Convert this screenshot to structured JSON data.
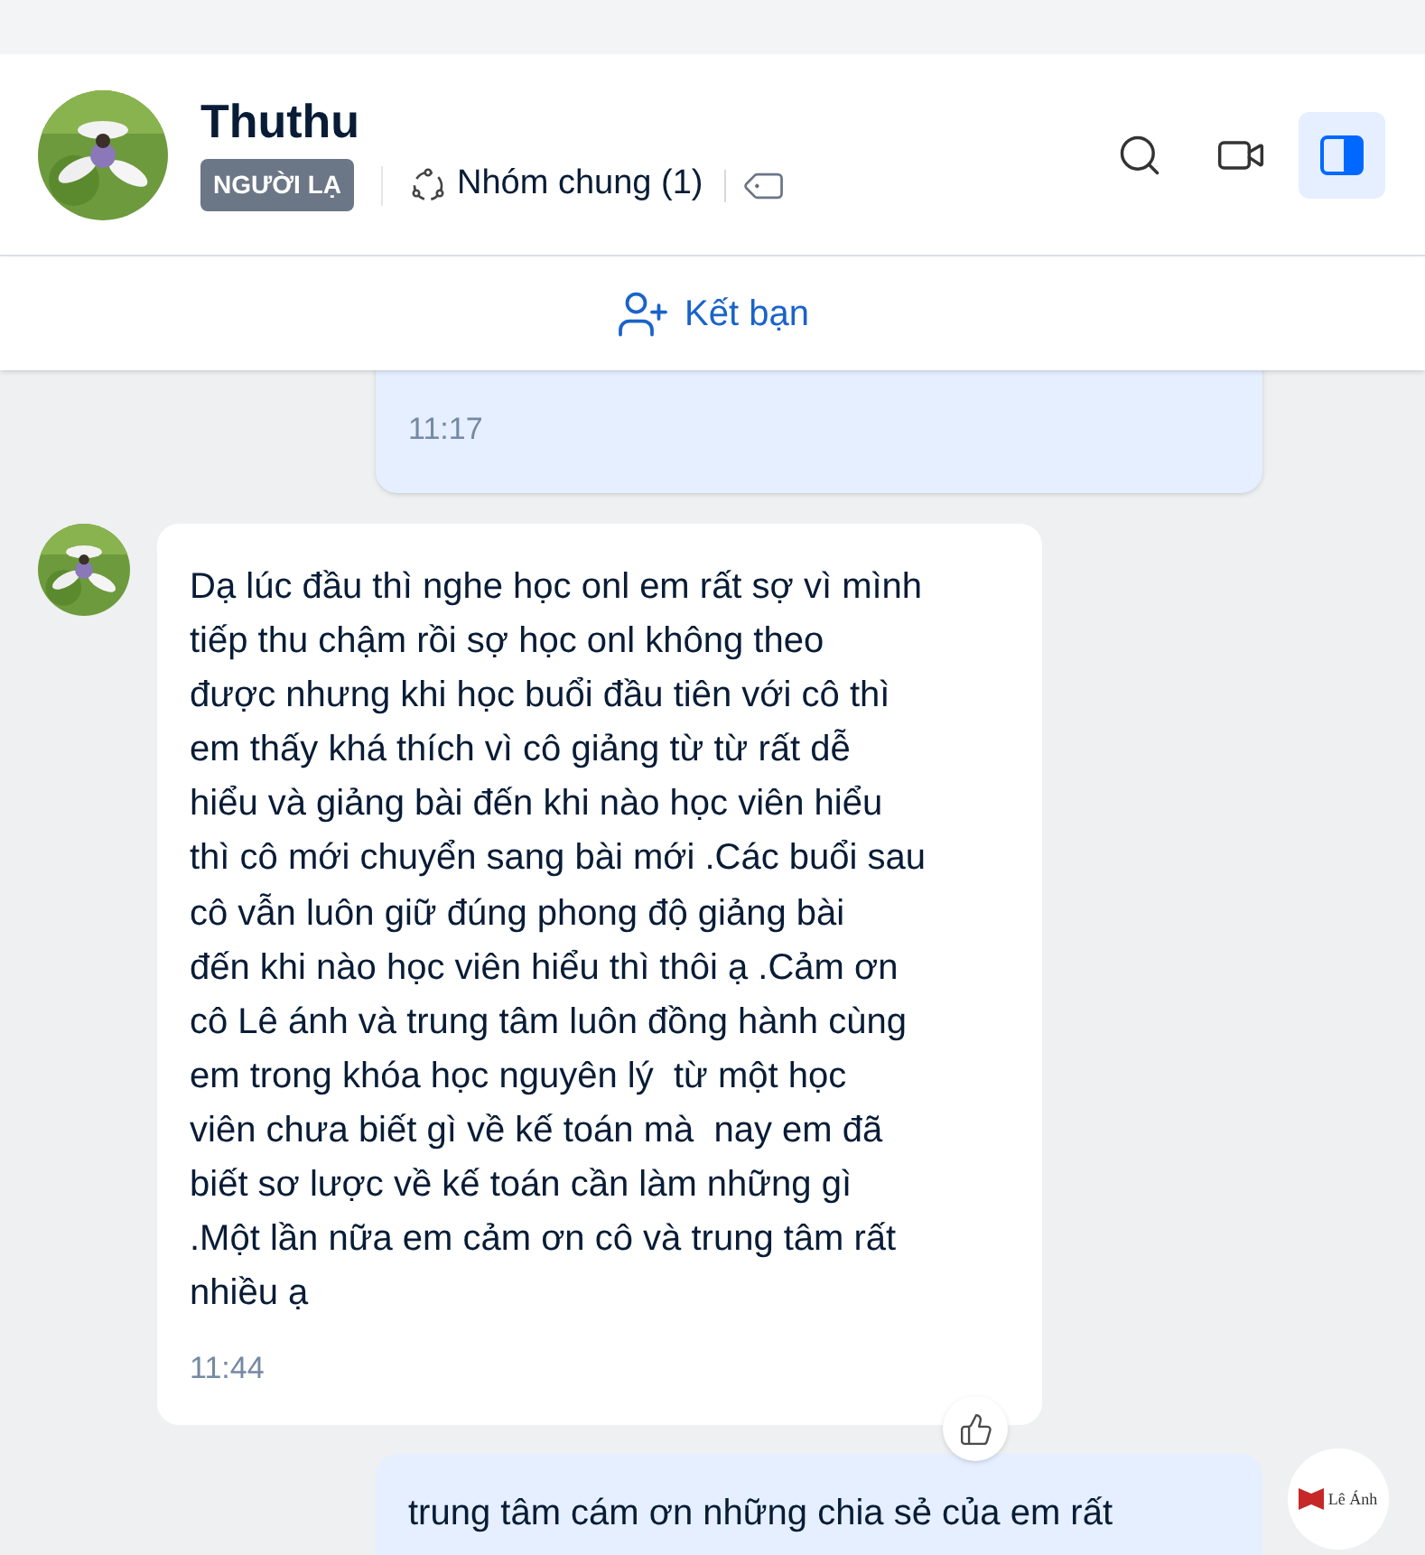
{
  "header": {
    "name": "Thuthu",
    "badge": "NGƯỜI LẠ",
    "group": "Nhóm chung (1)",
    "panel_toggle": {
      "selected": true
    }
  },
  "friend_bar": {
    "label": "Kết bạn"
  },
  "messages": [
    {
      "kind": "sent",
      "time": "11:17"
    },
    {
      "kind": "received",
      "text": "Dạ lúc đầu thì nghe học onl em rất sợ vì mình\ntiếp thu chậm rồi sợ học onl không theo\nđược nhưng khi học buổi đầu tiên với cô thì\nem thấy khá thích vì cô giảng từ từ rất dễ\nhiểu và giảng bài đến khi nào học viên hiểu\nthì cô mới chuyển sang bài mới .Các buổi sau\ncô vẫn luôn giữ đúng phong độ giảng bài\nđến khi nào học viên hiểu thì thôi ạ .Cảm ơn\ncô Lê ánh và trung tâm luôn đồng hành cùng\nem trong khóa học nguyên lý  từ một học\nviên chưa biết gì về kế toán mà  nay em đã\nbiết sơ lược về kế toán cần làm những gì\n.Một lần nữa em cảm ơn cô và trung tâm rất\nnhiều ạ",
      "time": "11:44"
    },
    {
      "kind": "sent",
      "text": "trung tâm cám ơn những chia sẻ của em rất",
      "avatar_logo": "Lê Ánh"
    }
  ]
}
